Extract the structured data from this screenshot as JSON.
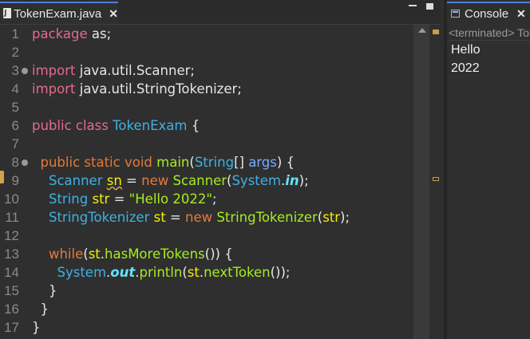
{
  "editor": {
    "tab": {
      "title": "TokenExam.java",
      "close": "✕",
      "icon": "java-file-icon"
    }
  },
  "gutter": {
    "lines": [
      "1",
      "2",
      "3",
      "4",
      "5",
      "6",
      "7",
      "8",
      "9",
      "10",
      "11",
      "12",
      "13",
      "14",
      "15",
      "16",
      "17"
    ]
  },
  "code": {
    "lines": [
      [
        [
          "kw",
          "package"
        ],
        [
          "plain",
          " as;"
        ]
      ],
      [],
      [
        [
          "kw",
          "import"
        ],
        [
          "plain",
          " java.util.Scanner;"
        ]
      ],
      [
        [
          "kw",
          "import"
        ],
        [
          "plain",
          " java.util.StringTokenizer;"
        ]
      ],
      [],
      [
        [
          "kw",
          "public"
        ],
        [
          "plain",
          " "
        ],
        [
          "kw",
          "class"
        ],
        [
          "plain",
          " "
        ],
        [
          "typ",
          "TokenExam"
        ],
        [
          "plain",
          " {"
        ]
      ],
      [],
      [
        [
          "plain",
          "  "
        ],
        [
          "kw2",
          "public"
        ],
        [
          "plain",
          " "
        ],
        [
          "kw2",
          "static"
        ],
        [
          "plain",
          " "
        ],
        [
          "kw2",
          "void"
        ],
        [
          "plain",
          " "
        ],
        [
          "meth",
          "main"
        ],
        [
          "plain",
          "("
        ],
        [
          "typ",
          "String"
        ],
        [
          "plain",
          "[] "
        ],
        [
          "arg",
          "args"
        ],
        [
          "plain",
          ") {"
        ]
      ],
      [
        [
          "plain",
          "    "
        ],
        [
          "typ",
          "Scanner"
        ],
        [
          "plain",
          " "
        ],
        [
          "var ul",
          "sn"
        ],
        [
          "plain",
          " = "
        ],
        [
          "kw2",
          "new"
        ],
        [
          "plain",
          " "
        ],
        [
          "meth",
          "Scanner"
        ],
        [
          "plain",
          "("
        ],
        [
          "typ",
          "System"
        ],
        [
          "plain",
          "."
        ],
        [
          "fld",
          "in"
        ],
        [
          "plain",
          ");"
        ]
      ],
      [
        [
          "plain",
          "    "
        ],
        [
          "typ",
          "String"
        ],
        [
          "plain",
          " "
        ],
        [
          "var",
          "str"
        ],
        [
          "plain",
          " = "
        ],
        [
          "str",
          "\"Hello 2022\""
        ],
        [
          "plain",
          ";"
        ]
      ],
      [
        [
          "plain",
          "    "
        ],
        [
          "typ",
          "StringTokenizer"
        ],
        [
          "plain",
          " "
        ],
        [
          "var",
          "st"
        ],
        [
          "plain",
          " = "
        ],
        [
          "kw2",
          "new"
        ],
        [
          "plain",
          " "
        ],
        [
          "meth",
          "StringTokenizer"
        ],
        [
          "plain",
          "("
        ],
        [
          "var",
          "str"
        ],
        [
          "plain",
          ");"
        ]
      ],
      [],
      [
        [
          "plain",
          "    "
        ],
        [
          "kw2",
          "while"
        ],
        [
          "plain",
          "("
        ],
        [
          "var",
          "st"
        ],
        [
          "plain",
          "."
        ],
        [
          "meth",
          "hasMoreTokens"
        ],
        [
          "plain",
          "()) {"
        ]
      ],
      [
        [
          "plain",
          "      "
        ],
        [
          "typ",
          "System"
        ],
        [
          "plain",
          "."
        ],
        [
          "fld",
          "out"
        ],
        [
          "plain",
          "."
        ],
        [
          "meth",
          "println"
        ],
        [
          "plain",
          "("
        ],
        [
          "var",
          "st"
        ],
        [
          "plain",
          "."
        ],
        [
          "meth",
          "nextToken"
        ],
        [
          "plain",
          "());"
        ]
      ],
      [
        [
          "plain",
          "    }"
        ]
      ],
      [
        [
          "plain",
          "  }"
        ]
      ],
      [
        [
          "plain",
          "}"
        ]
      ]
    ]
  },
  "console": {
    "title": "Console",
    "close": "✕",
    "icon": "console-icon",
    "status": "<terminated> TokenExam [Java Application]",
    "output": [
      "Hello",
      "2022"
    ]
  }
}
